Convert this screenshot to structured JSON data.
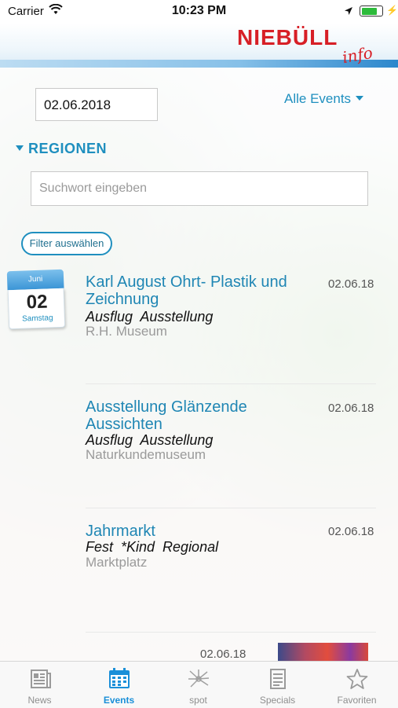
{
  "status_bar": {
    "carrier": "Carrier",
    "time": "10:23 PM",
    "battery_level": 0.9
  },
  "header": {
    "brand": "NIEBÜLL",
    "brand_sub": "info"
  },
  "date_filter": {
    "value": "02.06.2018"
  },
  "events_filter": {
    "label": "Alle Events"
  },
  "regions": {
    "label": "REGIONEN"
  },
  "search": {
    "placeholder": "Suchwort eingeben"
  },
  "filter_button": {
    "label": "Filter auswählen"
  },
  "calendar_badge": {
    "month": "Juni",
    "day": "02",
    "weekday": "Samstag"
  },
  "events": [
    {
      "title": "Karl August Ohrt- Plastik und Zeichnung",
      "categories": "Ausflug  Ausstellung",
      "location": "R.H. Museum",
      "date": "02.06.18"
    },
    {
      "title": "Ausstellung Glänzende Aussichten",
      "categories": "Ausflug  Ausstellung",
      "location": "Naturkundemuseum",
      "date": "02.06.18"
    },
    {
      "title": "Jahrmarkt",
      "categories": "Fest  *Kind  Regional",
      "location": "Marktplatz",
      "date": "02.06.18"
    },
    {
      "date": "02.06.18"
    }
  ],
  "tabbar": {
    "items": [
      {
        "label": "News",
        "icon": "newspaper-icon"
      },
      {
        "label": "Events",
        "icon": "calendar-icon"
      },
      {
        "label": "spot",
        "icon": "spot-icon"
      },
      {
        "label": "Specials",
        "icon": "specials-list-icon"
      },
      {
        "label": "Favoriten",
        "icon": "star-icon"
      }
    ],
    "active": "Events"
  },
  "colors": {
    "accent": "#1f8fbf",
    "brand_red": "#d71f26",
    "tab_active": "#1a8fd8"
  }
}
